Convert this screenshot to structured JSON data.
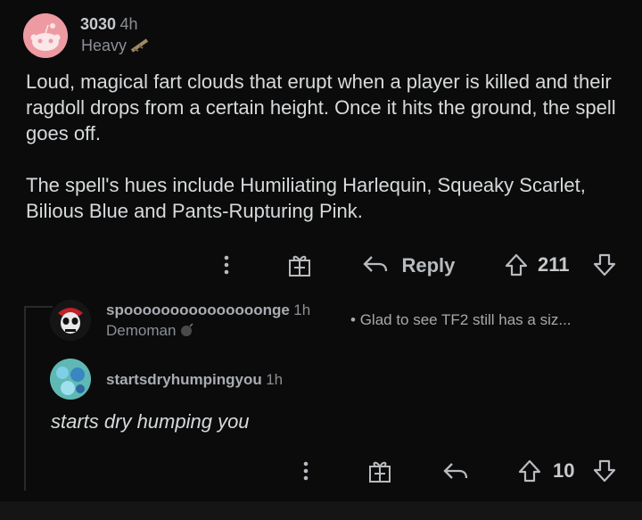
{
  "comment": {
    "username": "3030",
    "age": "4h",
    "flair": "Heavy",
    "body_paragraphs": [
      "Loud, magical fart clouds that erupt when a player is killed and their ragdoll drops from a certain height. Once it hits the ground, the spell goes off.",
      "The spell's hues include Humiliating Harlequin, Squeaky Scarlet, Bilious Blue and Pants-Rupturing Pink."
    ],
    "reply_label": "Reply",
    "score": "211"
  },
  "replies": [
    {
      "username": "spooooooooooooooonge",
      "age": "1h",
      "flair": "Demoman",
      "preview": "Glad to see TF2 still has a siz..."
    },
    {
      "username": "startsdryhumpingyou",
      "age": "1h",
      "body": "starts dry humping you",
      "score": "10"
    }
  ],
  "icons": {
    "more": "more-vertical-icon",
    "award": "gift-award-icon",
    "reply": "reply-arrow-icon",
    "upvote": "upvote-arrow-icon",
    "downvote": "downvote-arrow-icon"
  },
  "colors": {
    "background": "#0b0b0b",
    "text": "#d7dadc",
    "muted": "#8b8f94",
    "avatar_main": "#ee9aa2"
  }
}
